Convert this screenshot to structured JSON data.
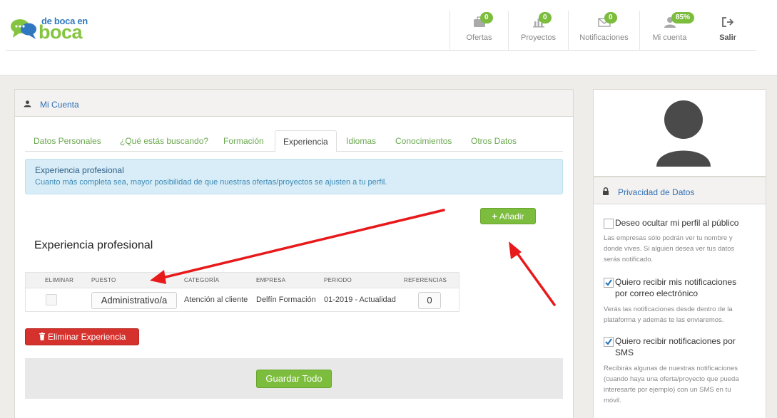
{
  "logo": {
    "small": "de boca en",
    "big": "boca"
  },
  "nav": [
    {
      "label": "Ofertas",
      "badge": "0",
      "icon": "briefcase-icon"
    },
    {
      "label": "Proyectos",
      "badge": "0",
      "icon": "chart-icon"
    },
    {
      "label": "Notificaciones",
      "badge": "0",
      "icon": "envelope-icon"
    },
    {
      "label": "Mi cuenta",
      "badge": "85%",
      "icon": "user-icon"
    },
    {
      "label": "Salir",
      "icon": "sign-out-icon"
    }
  ],
  "main": {
    "title": "Mi Cuenta",
    "tabs": [
      "Datos Personales",
      "¿Qué estás buscando?",
      "Formación",
      "Experiencia",
      "Idiomas",
      "Conocimientos",
      "Otros Datos"
    ],
    "active_tab": "Experiencia",
    "info": {
      "heading": "Experiencia profesional",
      "body": "Cuanto más completa sea, mayor posibilidad de que nuestras ofertas/proyectos se ajusten a tu perfil."
    },
    "add_button": "Añadir",
    "section_title": "Experiencia profesional",
    "table": {
      "headers": [
        "ELIMINAR",
        "PUESTO",
        "CATEGORÍA",
        "EMPRESA",
        "PERIODO",
        "REFERENCIAS"
      ],
      "rows": [
        {
          "puesto": "Administrativo/a",
          "categoria": "Atención al cliente",
          "empresa": "Delfín Formación",
          "periodo": "01-2019 - Actualidad",
          "referencias": "0"
        }
      ]
    },
    "delete_button": "Eliminar Experiencia",
    "save_button": "Guardar Todo"
  },
  "privacy": {
    "title": "Privacidad de Datos",
    "options": [
      {
        "label": "Deseo ocultar mi perfil al público",
        "checked": false,
        "help": "Las empresas sólo podrán ver tu nombre y donde vives. Si alguien desea ver tus datos serás notificado."
      },
      {
        "label": "Quiero recibir mis notificaciones por correo electrónico",
        "checked": true,
        "help": "Verás las notificaciones desde dentro de la plataforma y además te las enviaremos."
      },
      {
        "label": "Quiero recibir notificaciones por SMS",
        "checked": true,
        "help": "Recibirás algunas de nuestras notificaciones (cuando haya una oferta/proyecto que pueda interesarte por ejemplo) con un SMS en tu móvil."
      }
    ]
  },
  "colors": {
    "accent_green": "#7cbd3d",
    "link_blue": "#2f6fb5",
    "danger_red": "#d6322d",
    "annotation_red": "#e8191a"
  }
}
